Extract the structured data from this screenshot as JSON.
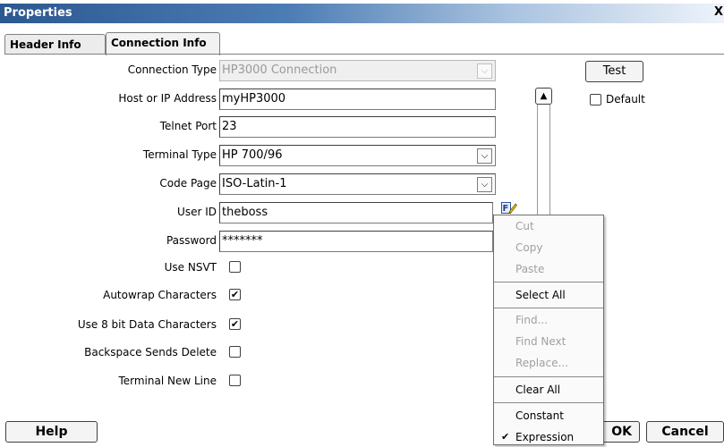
{
  "window": {
    "title": "Properties",
    "close_label": "X"
  },
  "tabs": [
    {
      "label": "Header Info",
      "active": false
    },
    {
      "label": "Connection Info",
      "active": true
    }
  ],
  "form": {
    "connection_type": {
      "label": "Connection Type",
      "value": "HP3000 Connection"
    },
    "host": {
      "label": "Host or IP Address",
      "value": "myHP3000"
    },
    "telnet_port": {
      "label": "Telnet Port",
      "value": "23"
    },
    "terminal_type": {
      "label": "Terminal Type",
      "value": "HP 700/96"
    },
    "code_page": {
      "label": "Code Page",
      "value": "ISO-Latin-1"
    },
    "user_id": {
      "label": "User ID",
      "value": "theboss"
    },
    "password": {
      "label": "Password",
      "value": "*******"
    },
    "use_nsvt": {
      "label": "Use NSVT",
      "checked": false
    },
    "autowrap": {
      "label": "Autowrap Characters",
      "checked": true
    },
    "use_8bit": {
      "label": "Use 8 bit Data Characters",
      "checked": true
    },
    "backspace_delete": {
      "label": "Backspace Sends Delete",
      "checked": false
    },
    "terminal_newline": {
      "label": "Terminal New Line",
      "checked": false
    }
  },
  "side": {
    "test_label": "Test",
    "default_label": "Default",
    "default_checked": false
  },
  "context_menu": {
    "items": [
      {
        "label": "Cut",
        "enabled": false
      },
      {
        "label": "Copy",
        "enabled": false
      },
      {
        "label": "Paste",
        "enabled": false
      },
      {
        "label": "Select All",
        "enabled": true
      },
      {
        "label": "Find...",
        "enabled": false
      },
      {
        "label": "Find Next",
        "enabled": false
      },
      {
        "label": "Replace...",
        "enabled": false
      },
      {
        "label": "Clear All",
        "enabled": true
      },
      {
        "label": "Constant",
        "enabled": true
      },
      {
        "label": "Expression",
        "enabled": true,
        "checked": true
      }
    ]
  },
  "bottom": {
    "help_label": "Help",
    "ok_label": "OK",
    "cancel_label": "Cancel"
  },
  "icons": {
    "combo_arrow": "chevron-down-icon",
    "scroll_up": "chevron-up-icon",
    "expression_editor": "edit-expression-icon",
    "check": "checkmark-icon"
  }
}
